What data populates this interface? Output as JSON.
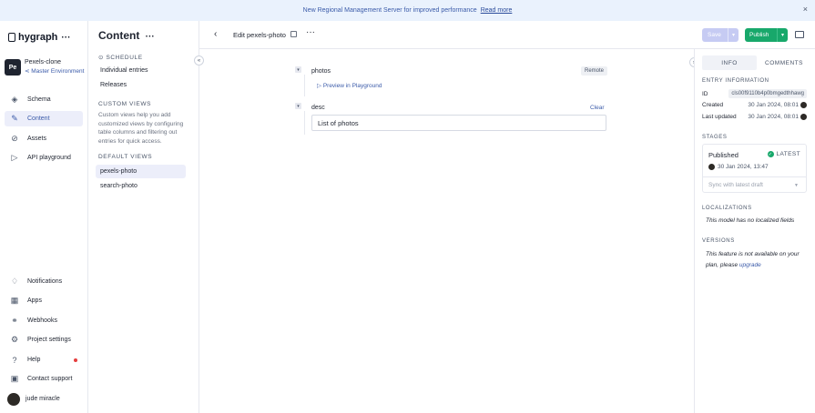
{
  "banner": {
    "text": "New Regional Management Server for improved performance",
    "link": "Read more",
    "close": "×"
  },
  "nav": {
    "brand": "hygraph",
    "brand_more": "···",
    "project_badge": "Pe",
    "project_name": "Pexels-clone",
    "environment": "Master Environment",
    "items": [
      {
        "label": "Schema",
        "icon": "schema-icon",
        "glyph": "◈"
      },
      {
        "label": "Content",
        "icon": "pencil-icon",
        "glyph": "✎"
      },
      {
        "label": "Assets",
        "icon": "paperclip-icon",
        "glyph": "⌕"
      },
      {
        "label": "API playground",
        "icon": "play-icon",
        "glyph": "▷"
      }
    ],
    "bottom": [
      {
        "label": "Notifications",
        "icon": "bell-icon",
        "glyph": "♫"
      },
      {
        "label": "Apps",
        "icon": "apps-icon",
        "glyph": "▦"
      },
      {
        "label": "Webhooks",
        "icon": "webhook-icon",
        "glyph": "⚭"
      },
      {
        "label": "Project settings",
        "icon": "gear-icon",
        "glyph": "⚙"
      },
      {
        "label": "Help",
        "icon": "help-icon",
        "glyph": "?"
      },
      {
        "label": "Contact support",
        "icon": "chat-icon",
        "glyph": "▣"
      },
      {
        "label": "jude miracle",
        "icon": "avatar"
      }
    ]
  },
  "content_sidebar": {
    "title": "Content",
    "more": "···",
    "schedule_heading": "SCHEDULE",
    "schedule_items": [
      "Individual entries",
      "Releases"
    ],
    "custom_heading": "CUSTOM VIEWS",
    "custom_desc": "Custom views help you add customized views by configuring table columns and filtering out entries for quick access.",
    "default_heading": "DEFAULT VIEWS",
    "default_items": [
      "pexels-photo",
      "search-photo"
    ]
  },
  "editor": {
    "title": "Edit pexels-photo",
    "more": "···",
    "save_label": "Save",
    "publish_label": "Publish",
    "fields": {
      "photos_label": "photos",
      "remote_badge": "Remote",
      "preview_link": "Preview in Playground",
      "desc_label": "desc",
      "clear_link": "Clear",
      "desc_value": "List of photos"
    }
  },
  "right_panel": {
    "tabs": [
      "INFO",
      "COMMENTS"
    ],
    "entry_heading": "ENTRY INFORMATION",
    "id_label": "ID",
    "id_value": "cls00f9110b4p0bmgedthhawg",
    "created_label": "Created",
    "created_value": "30 Jan 2024, 08:01",
    "updated_label": "Last updated",
    "updated_value": "30 Jan 2024, 08:01",
    "stages_heading": "STAGES",
    "stage_name": "Published",
    "stage_latest": "LATEST",
    "stage_date": "30 Jan 2024, 13:47",
    "sync_placeholder": "Sync with latest draft",
    "localizations_heading": "LOCALIZATIONS",
    "localizations_note": "This model has no localized fields",
    "versions_heading": "VERSIONS",
    "versions_note": "This feature is not available on your plan, please",
    "versions_link": "upgrade"
  },
  "colors": {
    "accent": "#3b5ba9",
    "publish": "#18a86b",
    "save_disabled": "#c6cbf3",
    "banner_bg": "#eaf2fd"
  }
}
